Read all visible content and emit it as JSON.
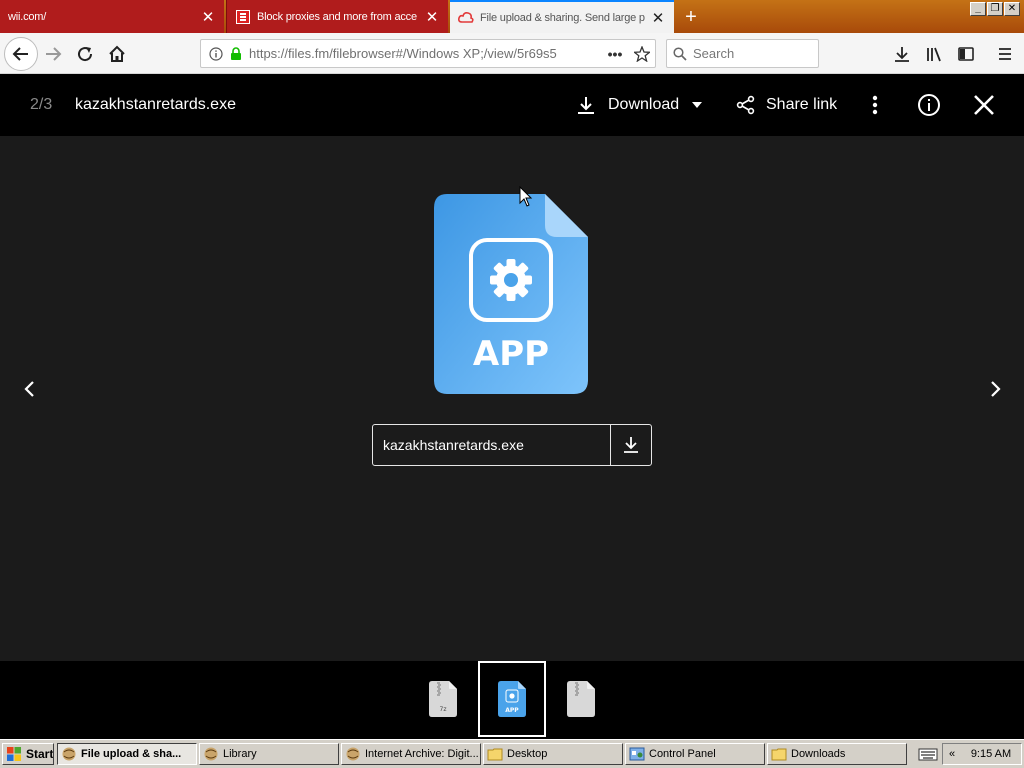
{
  "browser": {
    "tabs": [
      {
        "label": "wii.com/",
        "active": false
      },
      {
        "label": "Block proxies and more from acce",
        "active": false
      },
      {
        "label": "File upload & sharing. Send large p",
        "active": true
      }
    ],
    "url": "https://files.fm/filebrowser#/Windows XP;/view/5r69s5",
    "search_placeholder": "Search"
  },
  "viewer": {
    "counter": "2/3",
    "file_title": "kazakhstanretards.exe",
    "download_label": "Download",
    "share_label": "Share link",
    "file_icon_label": "APP",
    "filename_box": "kazakhstanretards.exe",
    "thumbnails": [
      {
        "kind": "archive",
        "label": "7z"
      },
      {
        "kind": "app",
        "label": "APP",
        "selected": true
      },
      {
        "kind": "archive",
        "label": ""
      }
    ]
  },
  "colors": {
    "tab_inactive": "#b01c1c",
    "titlebar_orange": "#c47216",
    "file_icon_blue": "#4aa3ea",
    "header_bg": "#000000",
    "viewer_bg": "#1b1b1b"
  },
  "taskbar": {
    "start_label": "Start",
    "tasks": [
      {
        "label": "File upload & sha...",
        "active": true
      },
      {
        "label": "Library",
        "active": false
      },
      {
        "label": "Internet Archive: Digit...",
        "active": false
      },
      {
        "label": "Desktop",
        "active": false
      },
      {
        "label": "Control Panel",
        "active": false
      },
      {
        "label": "Downloads",
        "active": false
      }
    ],
    "tray_chevron": "«",
    "clock": "9:15 AM"
  }
}
